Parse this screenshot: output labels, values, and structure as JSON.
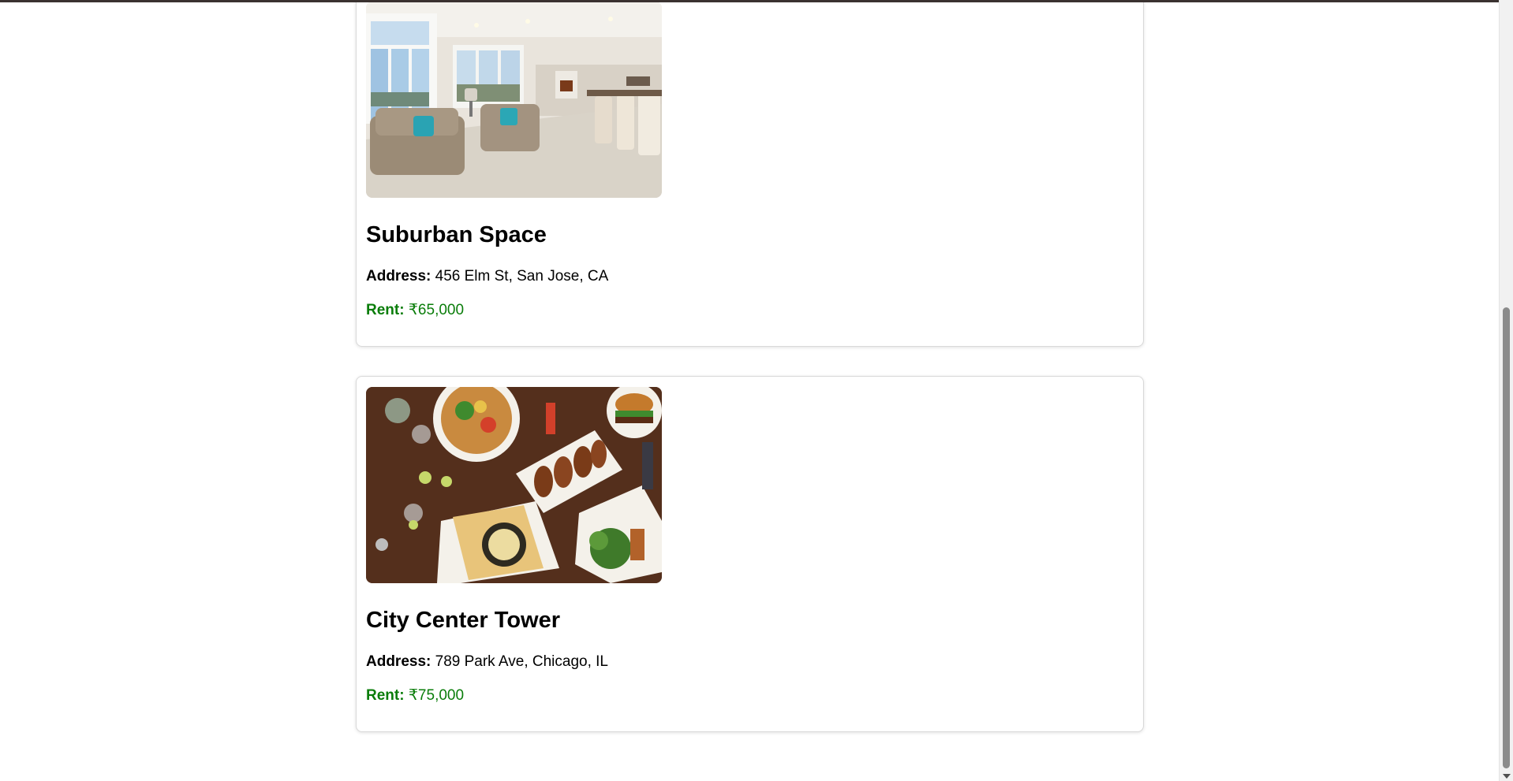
{
  "listings": [
    {
      "name": "Suburban Space",
      "address_label": "Address:",
      "address": "456 Elm St, San Jose, CA",
      "rent_label": "Rent:",
      "rent": "₹65,000",
      "image_icon": "living-room-photo"
    },
    {
      "name": "City Center Tower",
      "address_label": "Address:",
      "address": "789 Park Ave, Chicago, IL",
      "rent_label": "Rent:",
      "rent": "₹75,000",
      "image_icon": "food-table-photo"
    }
  ],
  "colors": {
    "rent": "#0a7d0a",
    "card_border": "#d9d9d9",
    "topbar": "#3a3230"
  }
}
